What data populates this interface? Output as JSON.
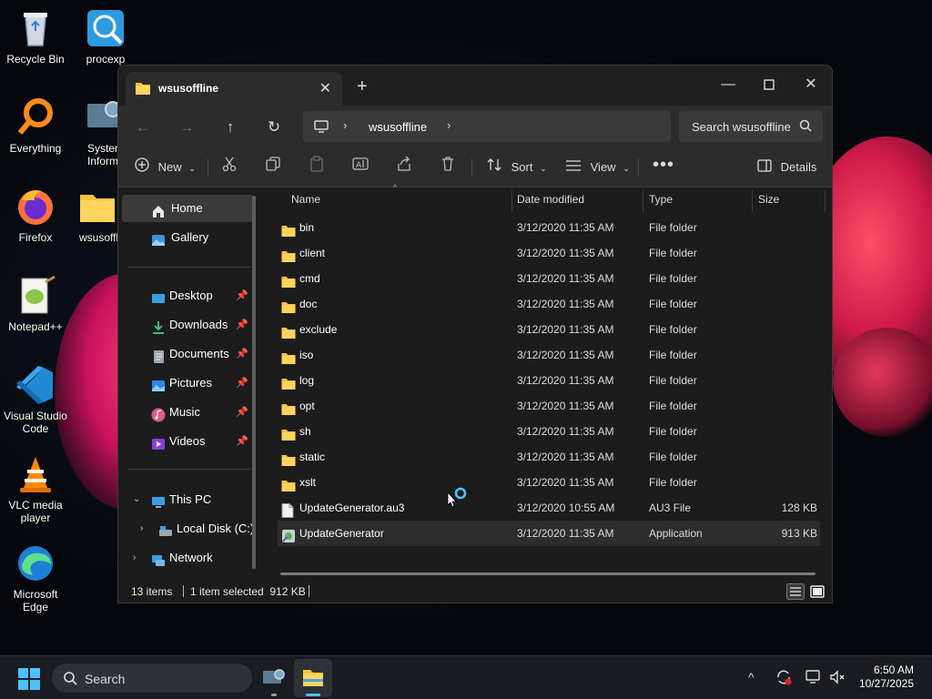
{
  "desktop": {
    "icons": [
      {
        "label": "Recycle Bin",
        "icon": "recycle-bin-icon"
      },
      {
        "label": "procexp",
        "icon": "procexp-icon"
      },
      {
        "label": "Everything",
        "icon": "everything-icon"
      },
      {
        "label": "System Inform",
        "icon": "system-information-icon"
      },
      {
        "label": "Firefox",
        "icon": "firefox-icon"
      },
      {
        "label": "wsusoffl",
        "icon": "folder-icon"
      },
      {
        "label": "Notepad++",
        "icon": "notepad-plus-plus-icon"
      },
      {
        "label": "Visual Studio Code",
        "icon": "vscode-icon"
      },
      {
        "label": "VLC media player",
        "icon": "vlc-icon"
      },
      {
        "label": "Microsoft Edge",
        "icon": "edge-icon"
      }
    ]
  },
  "window": {
    "tab_title": "wsusoffline",
    "address": {
      "crumb": "wsusoffline"
    },
    "search_placeholder": "Search wsusoffline",
    "commands": {
      "new": "New",
      "sort": "Sort",
      "view": "View",
      "details": "Details"
    },
    "sidebar": {
      "home": "Home",
      "gallery": "Gallery",
      "quick": [
        {
          "label": "Desktop",
          "icon": "desktop-icon"
        },
        {
          "label": "Downloads",
          "icon": "downloads-icon"
        },
        {
          "label": "Documents",
          "icon": "documents-icon"
        },
        {
          "label": "Pictures",
          "icon": "pictures-icon"
        },
        {
          "label": "Music",
          "icon": "music-icon"
        },
        {
          "label": "Videos",
          "icon": "videos-icon"
        }
      ],
      "this_pc": "This PC",
      "local_disk": "Local Disk (C:)",
      "network": "Network"
    },
    "columns": {
      "name": "Name",
      "date": "Date modified",
      "type": "Type",
      "size": "Size"
    },
    "files": [
      {
        "name": "bin",
        "date": "3/12/2020 11:35 AM",
        "type": "File folder",
        "size": "",
        "kind": "folder"
      },
      {
        "name": "client",
        "date": "3/12/2020 11:35 AM",
        "type": "File folder",
        "size": "",
        "kind": "folder"
      },
      {
        "name": "cmd",
        "date": "3/12/2020 11:35 AM",
        "type": "File folder",
        "size": "",
        "kind": "folder"
      },
      {
        "name": "doc",
        "date": "3/12/2020 11:35 AM",
        "type": "File folder",
        "size": "",
        "kind": "folder"
      },
      {
        "name": "exclude",
        "date": "3/12/2020 11:35 AM",
        "type": "File folder",
        "size": "",
        "kind": "folder"
      },
      {
        "name": "iso",
        "date": "3/12/2020 11:35 AM",
        "type": "File folder",
        "size": "",
        "kind": "folder"
      },
      {
        "name": "log",
        "date": "3/12/2020 11:35 AM",
        "type": "File folder",
        "size": "",
        "kind": "folder"
      },
      {
        "name": "opt",
        "date": "3/12/2020 11:35 AM",
        "type": "File folder",
        "size": "",
        "kind": "folder"
      },
      {
        "name": "sh",
        "date": "3/12/2020 11:35 AM",
        "type": "File folder",
        "size": "",
        "kind": "folder"
      },
      {
        "name": "static",
        "date": "3/12/2020 11:35 AM",
        "type": "File folder",
        "size": "",
        "kind": "folder"
      },
      {
        "name": "xslt",
        "date": "3/12/2020 11:35 AM",
        "type": "File folder",
        "size": "",
        "kind": "folder"
      },
      {
        "name": "UpdateGenerator.au3",
        "date": "3/12/2020 10:55 AM",
        "type": "AU3 File",
        "size": "128 KB",
        "kind": "file"
      },
      {
        "name": "UpdateGenerator",
        "date": "3/12/2020 11:35 AM",
        "type": "Application",
        "size": "913 KB",
        "kind": "app",
        "selected": true
      }
    ],
    "status": {
      "count": "13 items",
      "selected": "1 item selected  912 KB"
    }
  },
  "taskbar": {
    "search_placeholder": "Search",
    "time": "6:50 AM",
    "date": "10/27/2025"
  },
  "colors": {
    "folder": "#f5c242",
    "accent": "#4cc2ff",
    "window_bg": "#1c1c1c",
    "toolbar_bg": "#2c2c2c"
  }
}
